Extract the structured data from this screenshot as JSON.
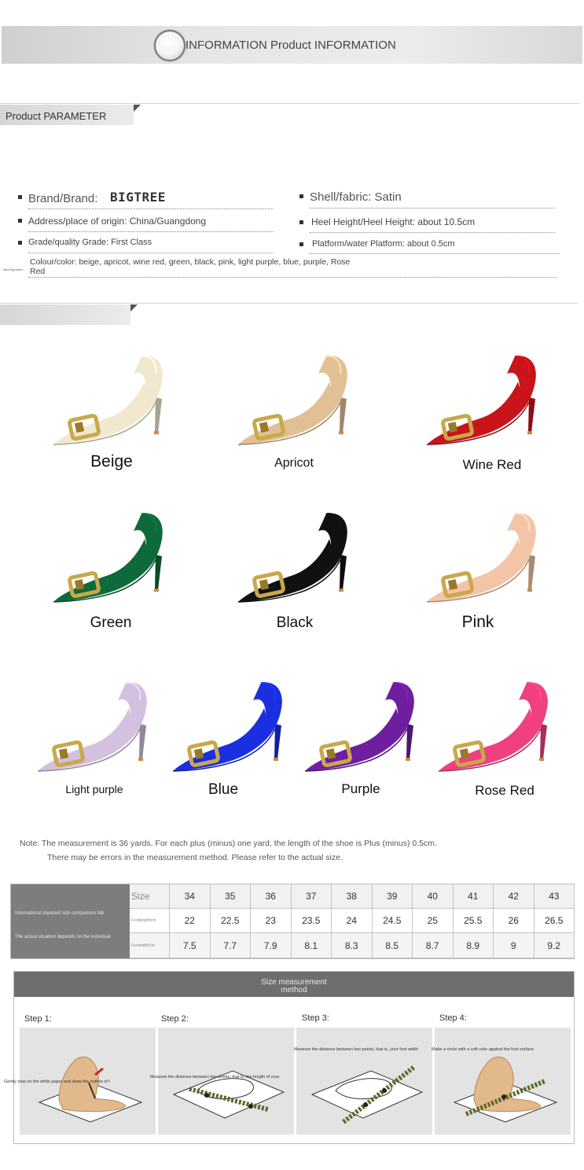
{
  "header": {
    "title": "INFORMATION Product INFORMATION"
  },
  "parameter_section": {
    "tab_label": "Product PARAMETER",
    "brand_label": "Brand/Brand:",
    "brand_value": "BIGTREE",
    "shell": "Shell/fabric: Satin",
    "origin": "Address/place of origin: China/Guangdong",
    "heel": "Heel Height/Heel Height: about 10.5cm",
    "grade": "Grade/quality Grade: First Class",
    "platform": "Platform/water Platform: about 0.5cm",
    "colour_line1": "Colour/color: beige, apricot, wine red, green, black, pink, light purple, blue, purple, Rose",
    "colour_line2": "Red",
    "side_tiny": "labelSignature"
  },
  "colors": {
    "accent_gray": "#7d7d7d",
    "items": [
      {
        "name": "Beige",
        "hex": "#f1e8cf"
      },
      {
        "name": "Apricot",
        "hex": "#e2c095"
      },
      {
        "name": "Wine Red",
        "hex": "#c8141a"
      },
      {
        "name": "Green",
        "hex": "#0e6a3a"
      },
      {
        "name": "Black",
        "hex": "#111111"
      },
      {
        "name": "Pink",
        "hex": "#f3c5a6"
      },
      {
        "name": "Light purple",
        "hex": "#d4c1df"
      },
      {
        "name": "Blue",
        "hex": "#1a2fe0"
      },
      {
        "name": "Purple",
        "hex": "#6e1fa0"
      },
      {
        "name": "Rose Red",
        "hex": "#f0407f"
      }
    ]
  },
  "note": {
    "line1": "Note: The measurement is 36 yards. For each plus (minus) one yard, the length of the shoe is Plus (minus) 0.5cm.",
    "line2": "There may be errors in the measurement method. Please refer to the actual size."
  },
  "size_table": {
    "left_title": "International standard size comparison tab",
    "left_sub": "The actual situation depends on the individual",
    "size_label": "Size",
    "length_label": "Footlength/cm",
    "width_label": "Footwidth/cm",
    "sizes": [
      "34",
      "35",
      "36",
      "37",
      "38",
      "39",
      "40",
      "41",
      "42",
      "43"
    ],
    "lengths": [
      "22",
      "22.5",
      "23",
      "23.5",
      "24",
      "24.5",
      "25",
      "25.5",
      "26",
      "26.5"
    ],
    "widths": [
      "7.5",
      "7.7",
      "7.9",
      "8.1",
      "8.3",
      "8.5",
      "8.7",
      "8.9",
      "9",
      "9.2"
    ]
  },
  "measurement": {
    "title_line1": "Size measurement",
    "title_line2": "method",
    "steps": [
      {
        "label": "Step 1:",
        "caption": "Gently step on the white paper and draw the outline of t"
      },
      {
        "label": "Step 2:",
        "caption": "Measure the distance between two points, that is, the length of your"
      },
      {
        "label": "Step 3:",
        "caption": "Measure the distance between two points, that is, your foot width"
      },
      {
        "label": "Step 4:",
        "caption": "Make a circle with a soft ruler against the foot surface"
      }
    ]
  }
}
